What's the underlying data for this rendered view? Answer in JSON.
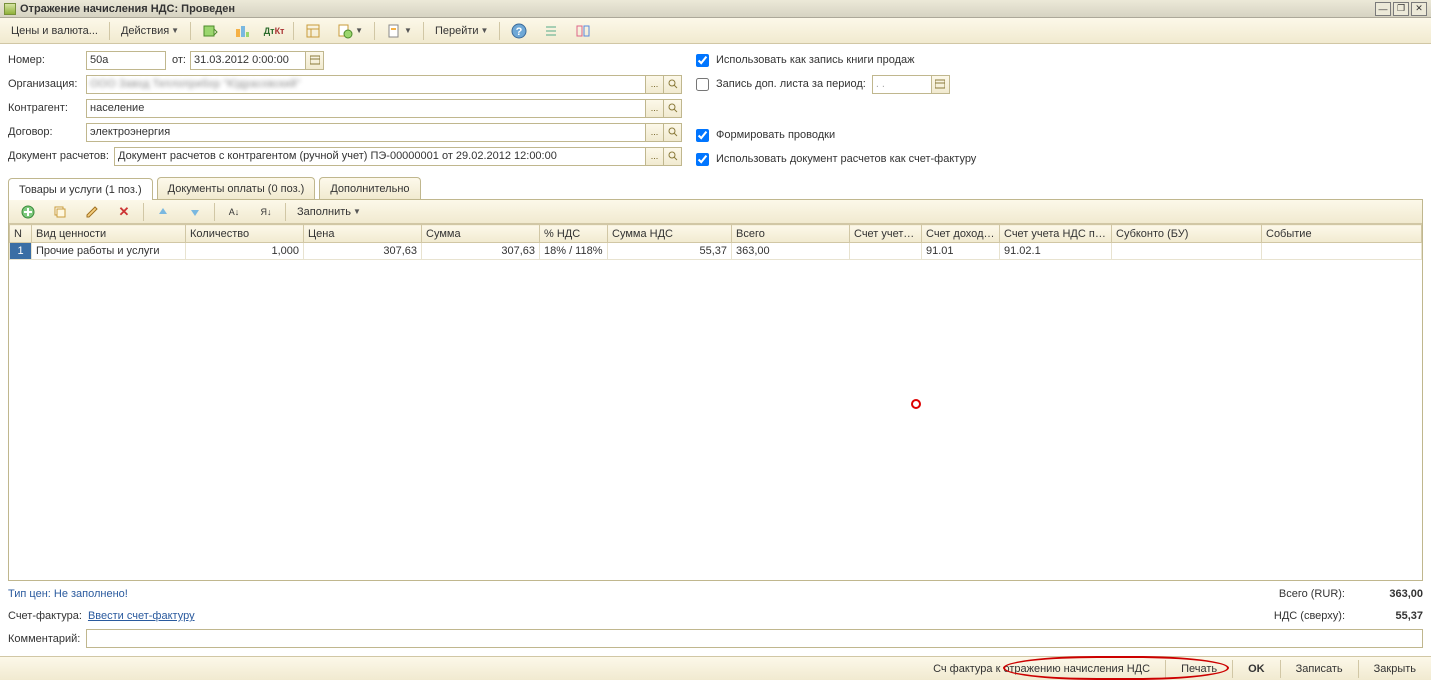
{
  "title": "Отражение начисления НДС: Проведен",
  "toolbar": {
    "prices": "Цены и валюта...",
    "actions": "Действия",
    "goto": "Перейти"
  },
  "form": {
    "number_label": "Номер:",
    "number": "50а",
    "date_label": "от:",
    "date": "31.03.2012 0:00:00",
    "org_label": "Организация:",
    "org": "ООО Завод Теплоприбор \"Юдрасовский\"",
    "contr_label": "Контрагент:",
    "contr": "население",
    "dog_label": "Договор:",
    "dog": "электроэнергия",
    "docr_label": "Документ расчетов:",
    "docr": "Документ расчетов с контрагентом (ручной учет) ПЭ-00000001 от 29.02.2012 12:00:00",
    "chk1": "Использовать как запись книги продаж",
    "chk2": "Запись доп. листа за период:",
    "period": ". .",
    "chk3": "Формировать проводки",
    "chk4": "Использовать документ расчетов как счет-фактуру"
  },
  "tabs": {
    "t1": "Товары и услуги (1 поз.)",
    "t2": "Документы оплаты (0 поз.)",
    "t3": "Дополнительно"
  },
  "grid_toolbar": {
    "fill": "Заполнить"
  },
  "grid": {
    "cols": [
      "N",
      "Вид ценности",
      "Количество",
      "Цена",
      "Сумма",
      "% НДС",
      "Сумма НДС",
      "Всего",
      "Счет учета (...",
      "Счет доходо...",
      "Счет учета НДС по ...",
      "Субконто (БУ)",
      "Событие"
    ],
    "row": {
      "n": "1",
      "vid": "Прочие работы и услуги",
      "qty": "1,000",
      "price": "307,63",
      "sum": "307,63",
      "pct": "18% / 118%",
      "nds": "55,37",
      "total": "363,00",
      "acc1": "",
      "acc2": "91.01",
      "acc3": "91.02.1",
      "sub": "",
      "ev": ""
    }
  },
  "footer": {
    "type_price": "Тип цен: Не заполнено!",
    "sf_label": "Счет-фактура:",
    "sf_link": "Ввести счет-фактуру",
    "comment_label": "Комментарий:",
    "total_label": "Всего (RUR):",
    "total": "363,00",
    "nds_label": "НДС (сверху):",
    "nds": "55,37"
  },
  "bottom": {
    "b1": "Сч фактура к отражению начисления НДС",
    "b2": "Печать",
    "b3": "OK",
    "b4": "Записать",
    "b5": "Закрыть"
  }
}
